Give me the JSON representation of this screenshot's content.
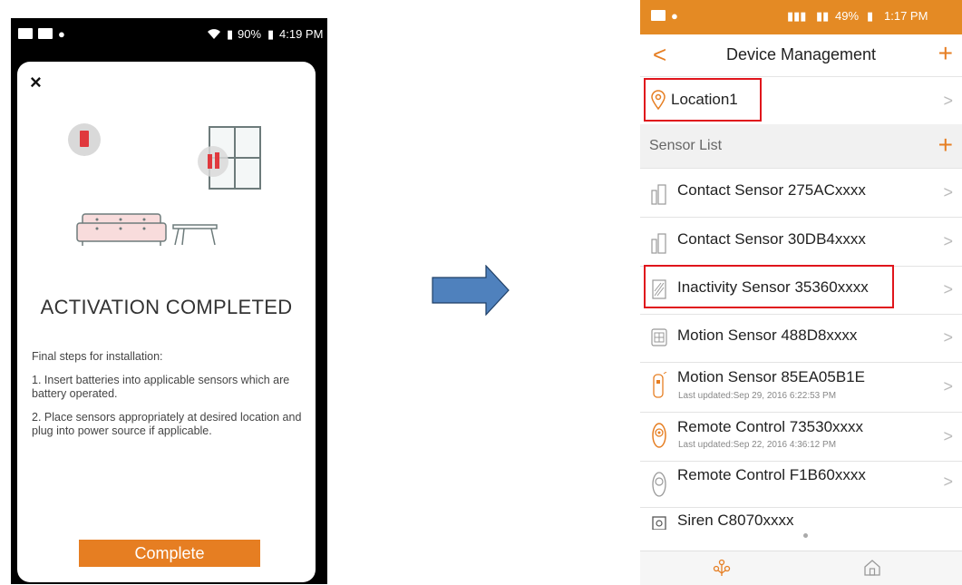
{
  "left_screen": {
    "status": {
      "battery": "90%",
      "time": "4:19 PM"
    },
    "close_label": "×",
    "title": "ACTIVATION COMPLETED",
    "steps_intro": "Final steps for installation:",
    "step1": "1. Insert batteries into applicable sensors which are battery operated.",
    "step2": "2. Place sensors appropriately at desired location and plug into power source if applicable.",
    "complete_label": "Complete"
  },
  "right_screen": {
    "status": {
      "battery": "49%",
      "time": "1:17 PM"
    },
    "header": {
      "title": "Device Management",
      "back_icon": "chevron-left-icon",
      "add_icon": "plus-icon"
    },
    "location": {
      "label": "Location1"
    },
    "sensor_section": {
      "label": "Sensor List"
    },
    "devices": [
      {
        "name": "Contact Sensor 275ACxxxx",
        "icon": "contact-sensor-icon"
      },
      {
        "name": "Contact Sensor 30DB4xxxx",
        "icon": "contact-sensor-icon"
      },
      {
        "name": "Inactivity Sensor 35360xxxx",
        "icon": "inactivity-sensor-icon"
      },
      {
        "name": "Motion Sensor 488D8xxxx",
        "icon": "motion-sensor-icon"
      },
      {
        "name": "Motion Sensor 85EA05B1E",
        "updated": "Last updated:Sep 29, 2016 6:22:53 PM",
        "icon": "motion-sensor-icon"
      },
      {
        "name": "Remote Control 73530xxxx",
        "updated": "Last updated:Sep 22, 2016 4:36:12 PM",
        "icon": "remote-control-icon"
      },
      {
        "name": "Remote Control F1B60xxxx",
        "icon": "remote-control-icon"
      },
      {
        "name": "Siren C8070xxxx",
        "icon": "siren-icon"
      }
    ],
    "colors": {
      "accent": "#e67e22",
      "status_bar": "#e48a24",
      "highlight": "#e0151c"
    }
  },
  "arrow": {
    "color": "#4f81bd"
  }
}
